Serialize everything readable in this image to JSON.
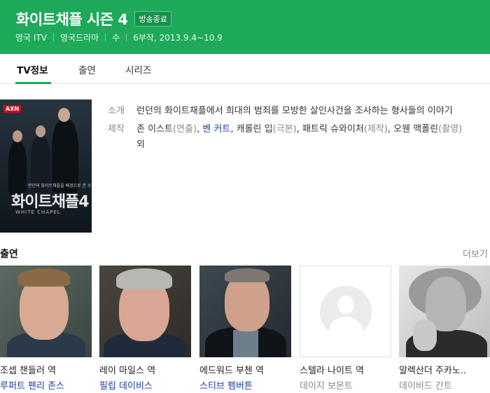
{
  "header": {
    "title": "화이트채플 시즌 4",
    "badge": "방송종료",
    "meta": [
      "영국 ITV",
      "영국드라마",
      "수",
      "6부작, 2013.9.4~10.9"
    ]
  },
  "tabs": [
    {
      "label": "TV정보",
      "active": true
    },
    {
      "label": "출연",
      "active": false
    },
    {
      "label": "시리즈",
      "active": false
    }
  ],
  "poster": {
    "channel": "AXN",
    "title": "화이트채플4",
    "subtitle": "WHITE CHAPEL",
    "tagline": "런던의 화이트채플을 배경으로 한 수사극"
  },
  "info": {
    "intro_label": "소개",
    "intro_text": "런던의 화이트채플에서 희대의 범죄를 모방한 살인사건을 조사하는 형사들의 이야기",
    "credits_label": "제작",
    "credits": {
      "c1": "존 이스트",
      "c1_role": "(연출)",
      "sep1": ", ",
      "c2": "벤 커트",
      "sep2": ", ",
      "c3": "캐롤린 입",
      "c3_role": "(극본)",
      "sep3": ", ",
      "c4": "패트릭 슈와이처",
      "c4_role": "(제작)",
      "sep4": ", ",
      "c5": "오웬 맥폴린",
      "c5_role": "(촬영)",
      "suffix": " 외"
    }
  },
  "cast": {
    "title": "출연",
    "more": "더보기",
    "items": [
      {
        "role": "조셉 챈들러 역",
        "actor": "루퍼트 펜리 존스",
        "linked": true
      },
      {
        "role": "레이 마일스 역",
        "actor": "필립 데이비스",
        "linked": true
      },
      {
        "role": "에드워드 부첸 역",
        "actor": "스티브 펨버튼",
        "linked": true
      },
      {
        "role": "스텔라 나이트 역",
        "actor": "데이지 보몬트",
        "linked": false
      },
      {
        "role": "알렉산더 주카노..",
        "actor": "데이비드 간트",
        "linked": false
      }
    ]
  },
  "colors": {
    "brand_green": "#1ea95b",
    "link_blue": "#1a3e9c"
  },
  "icons": {
    "person_placeholder": "person-silhouette-icon"
  }
}
